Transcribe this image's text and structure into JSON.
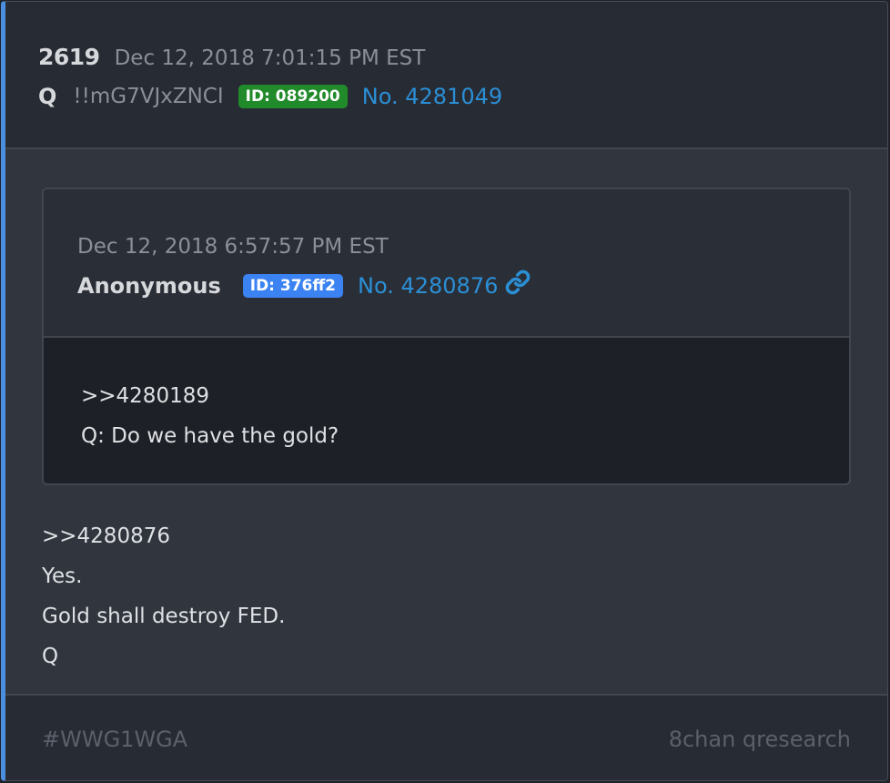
{
  "post": {
    "number": "2619",
    "timestamp": "Dec 12, 2018 7:01:15 PM EST",
    "author": "Q",
    "tripcode": "!!mG7VJxZNCI",
    "id_label": "ID: 089200",
    "post_no": "No. 4281049",
    "body": [
      ">>4280876",
      "Yes.",
      "Gold shall destroy FED.",
      "Q"
    ]
  },
  "quoted": {
    "timestamp": "Dec 12, 2018 6:57:57 PM EST",
    "author": "Anonymous",
    "id_label": "ID: 376ff2",
    "post_no": "No. 4280876",
    "link_icon": "link-icon",
    "body": [
      ">>4280189",
      "Q: Do we have the gold?"
    ]
  },
  "footer": {
    "hashtag": "#WWG1WGA",
    "source": "8chan qresearch"
  },
  "colors": {
    "accent": "#4c8fe0",
    "id_green": "#218a2a",
    "id_blue": "#3b82f2",
    "link": "#2b8fd6"
  }
}
